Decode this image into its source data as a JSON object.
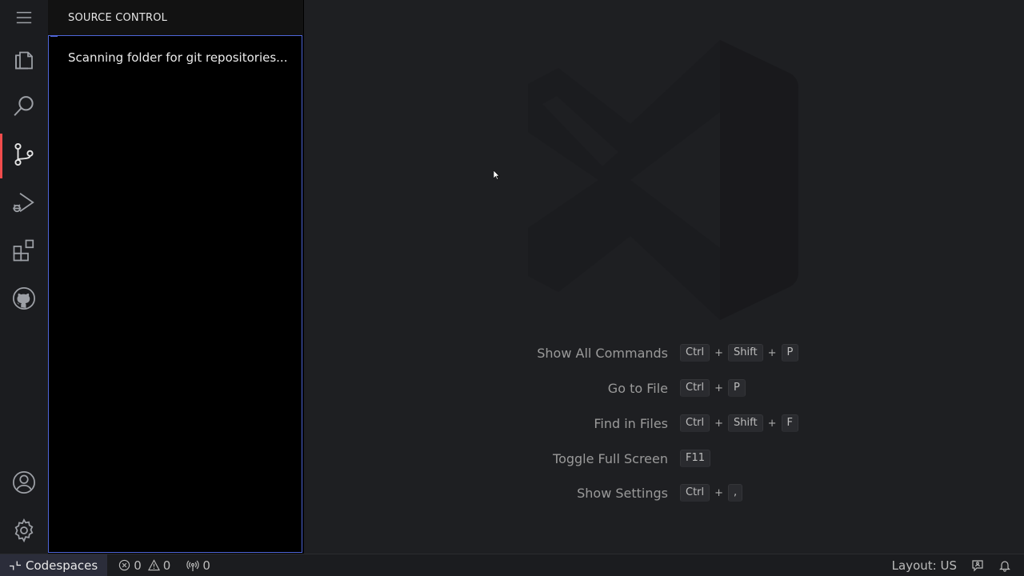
{
  "activity_bar": {
    "items": [
      {
        "name": "menu-icon"
      },
      {
        "name": "explorer-icon"
      },
      {
        "name": "search-icon"
      },
      {
        "name": "source-control-icon",
        "active": true
      },
      {
        "name": "run-debug-icon"
      },
      {
        "name": "extensions-icon"
      },
      {
        "name": "github-icon"
      },
      {
        "name": "accounts-icon"
      },
      {
        "name": "settings-gear-icon"
      }
    ],
    "active_indicator_color": "#f14c4c"
  },
  "sidebar": {
    "title": "SOURCE CONTROL",
    "message": "Scanning folder for git repositories...",
    "focus_border_color": "#4f66d9"
  },
  "editor": {
    "shortcuts": [
      {
        "label": "Show All Commands",
        "keys": [
          "Ctrl",
          "Shift",
          "P"
        ]
      },
      {
        "label": "Go to File",
        "keys": [
          "Ctrl",
          "P"
        ]
      },
      {
        "label": "Find in Files",
        "keys": [
          "Ctrl",
          "Shift",
          "F"
        ]
      },
      {
        "label": "Toggle Full Screen",
        "keys": [
          "F11"
        ]
      },
      {
        "label": "Show Settings",
        "keys": [
          "Ctrl",
          ","
        ]
      }
    ]
  },
  "statusbar": {
    "remote_label": "Codespaces",
    "errors": "0",
    "warnings": "0",
    "ports": "0",
    "layout": "Layout: US"
  }
}
